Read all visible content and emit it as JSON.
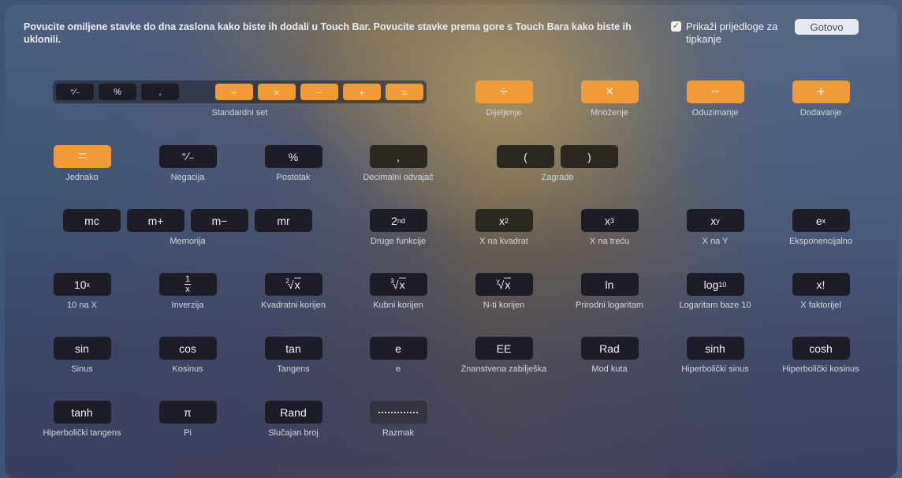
{
  "header": {
    "instructions": "Povucite omiljene stavke do dna zaslona kako biste ih dodali u Touch Bar. Povucite stavke prema gore s Touch Bara kako biste ih uklonili.",
    "suggestions_checkbox": {
      "label": "Prikaži prijedloge za tipkanje",
      "checked": true,
      "check_glyph": "✓"
    },
    "done_button": "Gotovo"
  },
  "standard_set": {
    "label": "Standardni set",
    "keys": [
      "⁺∕₋",
      "%",
      ",",
      "÷",
      "×",
      "−",
      "+",
      "="
    ]
  },
  "items": {
    "divide": {
      "key": "÷",
      "label": "Dijeljenje"
    },
    "multiply": {
      "key": "×",
      "label": "Množenje"
    },
    "subtract": {
      "key": "−",
      "label": "Oduzimanje"
    },
    "add": {
      "key": "+",
      "label": "Dodavanje"
    },
    "equals": {
      "key": "=",
      "label": "Jednako"
    },
    "negate": {
      "key": "⁺∕₋",
      "label": "Negacija"
    },
    "percent": {
      "key": "%",
      "label": "Postotak"
    },
    "decimal": {
      "key": ",",
      "label": "Decimalni odvajač"
    },
    "parens": {
      "keys": [
        "(",
        ")"
      ],
      "label": "Zagrade"
    },
    "memory": {
      "keys": [
        "mc",
        "m+",
        "m−",
        "mr"
      ],
      "label": "Memorija"
    },
    "second": {
      "base": "2",
      "sup": "nd",
      "label": "Druge funkcije"
    },
    "x_squared": {
      "base": "x",
      "sup": "2",
      "label": "X na kvadrat"
    },
    "x_cubed": {
      "base": "x",
      "sup": "3",
      "label": "X na treću"
    },
    "x_pow_y": {
      "base": "x",
      "sup": "y",
      "label": "X na Y"
    },
    "e_pow_x": {
      "base": "e",
      "sup": "x",
      "label": "Eksponencijalno"
    },
    "ten_pow_x": {
      "base": "10",
      "sup": "x",
      "label": "10 na X"
    },
    "inverse": {
      "num": "1",
      "den": "x",
      "label": "Inverzija"
    },
    "sqrt": {
      "index": "2",
      "radicand": "x",
      "label": "Kvadratni korijen"
    },
    "cbrt": {
      "index": "3",
      "radicand": "x",
      "label": "Kubni korijen"
    },
    "nthroot": {
      "index": "y",
      "radicand": "x",
      "label": "N-ti korijen"
    },
    "ln": {
      "key": "ln",
      "label": "Prirodni logaritam"
    },
    "log10": {
      "base": "log",
      "sub": "10",
      "label": "Logaritam baze 10"
    },
    "factorial": {
      "key": "x!",
      "label": "X faktorijel"
    },
    "sin": {
      "key": "sin",
      "label": "Sinus"
    },
    "cos": {
      "key": "cos",
      "label": "Kosinus"
    },
    "tan": {
      "key": "tan",
      "label": "Tangens"
    },
    "e": {
      "key": "e",
      "label": "e"
    },
    "ee": {
      "key": "EE",
      "label": "Znanstvena zabilješka"
    },
    "rad": {
      "key": "Rad",
      "label": "Mod kuta"
    },
    "sinh": {
      "key": "sinh",
      "label": "Hiperbolički sinus"
    },
    "cosh": {
      "key": "cosh",
      "label": "Hiperbolički kosinus"
    },
    "tanh": {
      "key": "tanh",
      "label": "Hiperbolički tangens"
    },
    "pi": {
      "key": "π",
      "label": "Pi"
    },
    "rand": {
      "key": "Rand",
      "label": "Slučajan broj"
    },
    "space": {
      "label": "Razmak"
    }
  },
  "colors": {
    "operator_key": "#f09a38",
    "function_key": "#1c1d26",
    "done_button_bg": "#e6eaf0"
  }
}
